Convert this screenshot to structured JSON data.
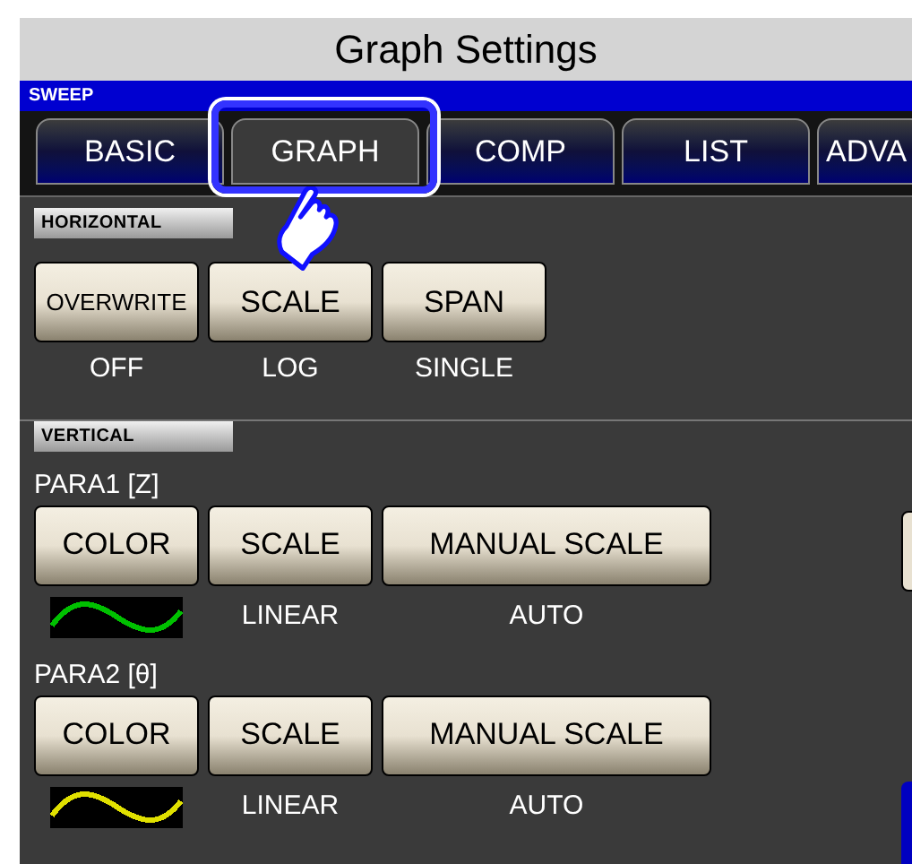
{
  "title": "Graph Settings",
  "mode": "SWEEP",
  "tabs": [
    {
      "label": "BASIC",
      "selected": false
    },
    {
      "label": "GRAPH",
      "selected": true
    },
    {
      "label": "COMP",
      "selected": false
    },
    {
      "label": "LIST",
      "selected": false
    },
    {
      "label": "ADVA",
      "selected": false
    }
  ],
  "horizontal": {
    "label": "HORIZONTAL",
    "settings": [
      {
        "button": "OVERWRITE",
        "value": "OFF"
      },
      {
        "button": "SCALE",
        "value": "LOG"
      },
      {
        "button": "SPAN",
        "value": "SINGLE"
      }
    ]
  },
  "vertical": {
    "label": "VERTICAL",
    "params": [
      {
        "name": "PARA1 [Z]",
        "color": "#00c000",
        "buttons": [
          "COLOR",
          "SCALE",
          "MANUAL SCALE"
        ],
        "scale": "LINEAR",
        "manual_scale": "AUTO"
      },
      {
        "name": "PARA2 [θ]",
        "color": "#e0e000",
        "buttons": [
          "COLOR",
          "SCALE",
          "MANUAL SCALE"
        ],
        "scale": "LINEAR",
        "manual_scale": "AUTO"
      }
    ]
  }
}
